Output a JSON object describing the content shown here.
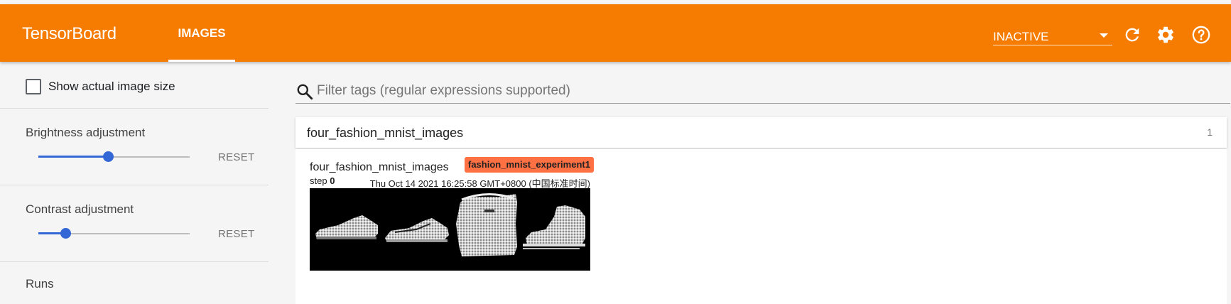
{
  "toolbar": {
    "brand": "TensorBoard",
    "tab_label": "IMAGES",
    "run_status": "INACTIVE",
    "icons": [
      "refresh-icon",
      "settings-icon",
      "help-icon"
    ],
    "color": "#f57c00"
  },
  "sidebar": {
    "show_actual_size_label": "Show actual image size",
    "brightness_label": "Brightness adjustment",
    "brightness_level": 0.46,
    "contrast_label": "Contrast adjustment",
    "contrast_level": 0.18,
    "reset_label": "RESET",
    "runs_label": "Runs",
    "accent": "#3367d6"
  },
  "main": {
    "filter_placeholder": "Filter tags (regular expressions supported)",
    "tag_group": {
      "name": "four_fashion_mnist_images",
      "count": "1"
    },
    "image_card": {
      "title": "four_fashion_mnist_images",
      "run": "fashion_mnist_experiment1",
      "run_color": "#ff7043",
      "step_label": "step",
      "step_value": "0",
      "timestamp": "Thu Oct 14 2021 16:25:58 GMT+0800 (中国标准时间)"
    }
  }
}
